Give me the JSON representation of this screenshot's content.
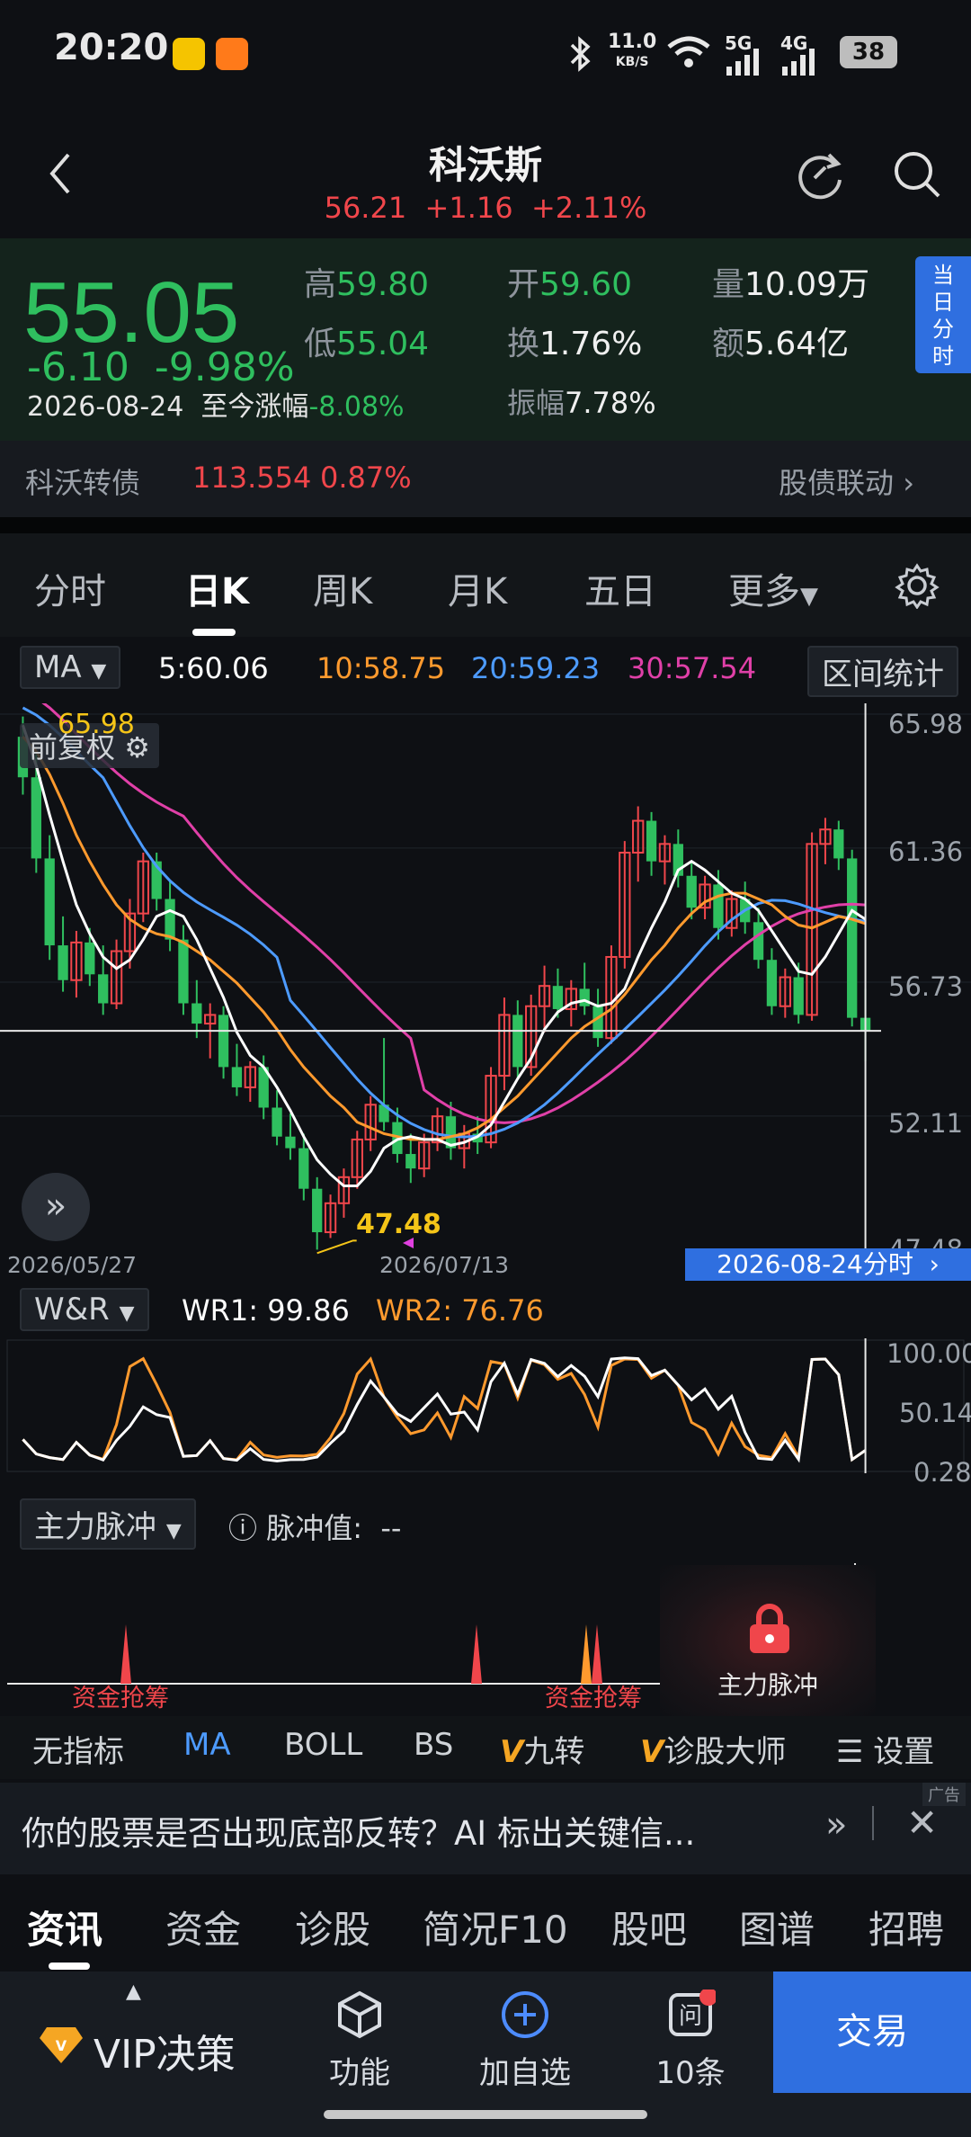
{
  "status_bar": {
    "time": "20:20",
    "net_speed_value": "11.0",
    "net_speed_unit": "KB/S",
    "signal1": "5G",
    "signal2": "4G",
    "battery": "38"
  },
  "header": {
    "title": "科沃斯",
    "sub_price": "56.21",
    "sub_change": "+1.16",
    "sub_pct": "+2.11%"
  },
  "quote": {
    "price": "55.05",
    "change": "-6.10",
    "change_pct": "-9.98%",
    "date": "2026-08-24",
    "ytd_label": "至今涨幅",
    "ytd_value": "-8.08%",
    "high_label": "高",
    "high": "59.80",
    "low_label": "低",
    "low": "55.04",
    "open_label": "开",
    "open": "59.60",
    "turnover_label": "换",
    "turnover": "1.76%",
    "volume_label": "量",
    "volume": "10.09万",
    "amount_label": "额",
    "amount": "5.64亿",
    "amplitude_label": "振幅",
    "amplitude": "7.78%",
    "today_btn": "当日分时"
  },
  "bond": {
    "name": "科沃转债",
    "price": "113.554",
    "pct": "0.87%",
    "link": "股债联动"
  },
  "period_tabs": [
    "分时",
    "日K",
    "周K",
    "月K",
    "五日",
    "更多"
  ],
  "ma_bar": {
    "selector": "MA",
    "ma5": "5:60.06",
    "ma10": "10:58.75",
    "ma20": "20:59.23",
    "ma30": "30:57.54",
    "stats_btn": "区间统计"
  },
  "main_chart": {
    "adjust_label": "前复权",
    "high_marker": "65.98",
    "low_marker": "47.48",
    "y_ticks": [
      "65.98",
      "61.36",
      "56.73",
      "52.11",
      "47.48"
    ],
    "x_start": "2026/05/27",
    "x_mid": "2026/07/13",
    "cursor_label": "2026-08-24分时"
  },
  "wr": {
    "selector": "W&R",
    "wr1": "WR1: 99.86",
    "wr2": "WR2: 76.76",
    "y_ticks": [
      "100.00",
      "50.14",
      "0.28"
    ]
  },
  "pulse": {
    "selector": "主力脉冲",
    "value_label": "脉冲值:",
    "value": "--",
    "tag1": "资金抢筹",
    "tag2": "资金抢筹",
    "locked_label": "主力脉冲"
  },
  "indicator_bar": [
    "无指标",
    "MA",
    "BOLL",
    "BS",
    "九转",
    "诊股大师",
    "设置"
  ],
  "ad": {
    "text": "你的股票是否出现底部反转？AI 标出关键信...",
    "tag": "广告"
  },
  "news_tabs": [
    "资讯",
    "资金",
    "诊股",
    "简况F10",
    "股吧",
    "图谱",
    "招聘"
  ],
  "bottom_nav": {
    "vip": "VIP决策",
    "func": "功能",
    "add": "加自选",
    "msgs": "10条",
    "trade": "交易"
  },
  "colors": {
    "down_green": "#2fbf5f",
    "up_red": "#f0464b",
    "ma5": "#ffffff",
    "ma10": "#ff9a2e",
    "ma20": "#4d9bff",
    "ma30": "#e040a8",
    "accent_blue": "#2f6fe0"
  },
  "chart_data": {
    "type": "candlestick",
    "ylim": [
      47.48,
      65.98
    ],
    "candles": [
      [
        65.2,
        65.9,
        63.2,
        63.8
      ],
      [
        63.8,
        64.6,
        60.5,
        61.0
      ],
      [
        61.0,
        61.8,
        57.5,
        58.0
      ],
      [
        58.0,
        59.0,
        56.4,
        56.8
      ],
      [
        56.8,
        58.5,
        56.2,
        58.1
      ],
      [
        58.1,
        58.6,
        56.6,
        57.0
      ],
      [
        57.0,
        58.0,
        55.6,
        56.0
      ],
      [
        56.0,
        58.2,
        55.8,
        57.8
      ],
      [
        57.8,
        59.6,
        57.2,
        59.1
      ],
      [
        59.1,
        61.2,
        58.8,
        60.9
      ],
      [
        60.9,
        61.2,
        59.2,
        59.6
      ],
      [
        59.6,
        60.2,
        57.8,
        58.2
      ],
      [
        58.2,
        58.7,
        55.6,
        56.0
      ],
      [
        56.0,
        56.8,
        54.8,
        55.3
      ],
      [
        55.3,
        56.0,
        54.1,
        55.6
      ],
      [
        55.6,
        55.9,
        53.4,
        53.8
      ],
      [
        53.8,
        54.6,
        52.8,
        53.1
      ],
      [
        53.1,
        54.0,
        52.6,
        53.8
      ],
      [
        53.8,
        54.2,
        52.0,
        52.4
      ],
      [
        52.4,
        53.0,
        51.1,
        51.4
      ],
      [
        51.4,
        52.2,
        50.6,
        51.0
      ],
      [
        51.0,
        51.5,
        49.2,
        49.6
      ],
      [
        49.6,
        50.0,
        47.5,
        48.1
      ],
      [
        48.1,
        49.4,
        47.9,
        49.1
      ],
      [
        49.1,
        50.3,
        48.6,
        50.0
      ],
      [
        50.0,
        51.6,
        49.6,
        51.3
      ],
      [
        51.3,
        52.8,
        50.9,
        52.5
      ],
      [
        52.5,
        54.8,
        51.6,
        51.9
      ],
      [
        51.9,
        52.4,
        50.5,
        50.8
      ],
      [
        50.8,
        51.5,
        49.8,
        50.3
      ],
      [
        50.3,
        51.5,
        50.0,
        51.2
      ],
      [
        51.2,
        52.4,
        50.9,
        52.1
      ],
      [
        52.1,
        52.6,
        50.6,
        51.0
      ],
      [
        51.0,
        51.8,
        50.3,
        51.5
      ],
      [
        51.5,
        52.1,
        50.8,
        51.2
      ],
      [
        51.2,
        53.8,
        51.0,
        53.5
      ],
      [
        53.5,
        56.2,
        53.0,
        55.6
      ],
      [
        55.6,
        56.1,
        53.4,
        53.8
      ],
      [
        53.8,
        56.3,
        53.5,
        55.9
      ],
      [
        55.9,
        57.3,
        55.0,
        56.6
      ],
      [
        56.6,
        57.2,
        55.5,
        55.8
      ],
      [
        55.8,
        56.8,
        55.2,
        56.5
      ],
      [
        56.5,
        57.4,
        55.6,
        55.9
      ],
      [
        55.9,
        56.5,
        54.5,
        54.8
      ],
      [
        54.8,
        58.0,
        54.6,
        57.6
      ],
      [
        57.6,
        61.6,
        57.2,
        61.2
      ],
      [
        61.2,
        62.8,
        60.2,
        62.3
      ],
      [
        62.3,
        62.6,
        60.4,
        60.9
      ],
      [
        60.9,
        61.8,
        60.1,
        61.5
      ],
      [
        61.5,
        62.0,
        60.0,
        60.4
      ],
      [
        60.4,
        60.9,
        58.9,
        59.3
      ],
      [
        59.3,
        60.4,
        58.9,
        60.1
      ],
      [
        60.1,
        60.6,
        58.2,
        58.6
      ],
      [
        58.6,
        59.9,
        58.3,
        59.6
      ],
      [
        59.6,
        60.2,
        58.4,
        58.8
      ],
      [
        58.8,
        59.3,
        57.2,
        57.5
      ],
      [
        57.5,
        57.9,
        55.6,
        55.9
      ],
      [
        55.9,
        57.2,
        55.5,
        56.9
      ],
      [
        56.9,
        57.4,
        55.3,
        55.6
      ],
      [
        55.6,
        61.9,
        55.4,
        61.5
      ],
      [
        61.5,
        62.4,
        60.8,
        62.0
      ],
      [
        62.0,
        62.3,
        60.6,
        61.0
      ],
      [
        61.0,
        61.3,
        55.2,
        55.5
      ],
      [
        55.5,
        56.5,
        54.0,
        55.05
      ]
    ],
    "ma5": [
      65.6,
      64.2,
      62.5,
      60.9,
      59.4,
      58.4,
      57.6,
      57.2,
      57.5,
      58.2,
      59.0,
      59.2,
      59.0,
      58.2,
      57.2,
      56.2,
      55.0,
      54.2,
      53.8,
      53.1,
      52.3,
      51.4,
      50.6,
      50.1,
      49.7,
      49.7,
      50.2,
      51.0,
      51.3,
      51.4,
      51.3,
      51.3,
      51.1,
      51.2,
      51.4,
      51.8,
      52.6,
      53.4,
      54.1,
      55.1,
      55.7,
      56.0,
      56.1,
      55.9,
      56.0,
      56.5,
      57.6,
      58.6,
      59.5,
      60.6,
      60.9,
      60.6,
      60.2,
      59.8,
      59.6,
      59.2,
      58.5,
      57.8,
      57.1,
      57.0,
      57.6,
      58.4,
      59.2,
      58.9
    ],
    "ma10": [
      65.2,
      64.7,
      63.9,
      62.9,
      61.8,
      60.9,
      60.1,
      59.4,
      58.9,
      58.6,
      58.4,
      58.3,
      58.1,
      57.8,
      57.5,
      57.1,
      56.7,
      56.2,
      55.7,
      55.1,
      54.4,
      53.8,
      53.3,
      52.8,
      52.4,
      51.9,
      51.7,
      51.5,
      51.4,
      51.3,
      51.3,
      51.3,
      51.4,
      51.5,
      51.7,
      52.0,
      52.4,
      52.8,
      53.3,
      53.8,
      54.3,
      54.8,
      55.2,
      55.5,
      55.8,
      56.3,
      56.9,
      57.5,
      58.0,
      58.6,
      59.1,
      59.5,
      59.7,
      59.8,
      59.8,
      59.6,
      59.4,
      59.0,
      58.7,
      58.6,
      58.8,
      59.0,
      58.9,
      58.75
    ]
  }
}
